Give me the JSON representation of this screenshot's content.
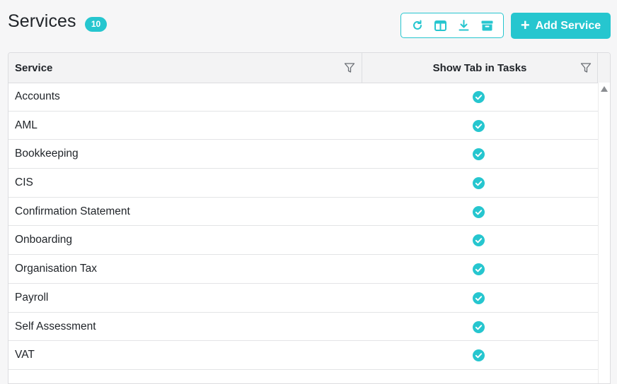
{
  "header": {
    "title": "Services",
    "count": "10",
    "add_button_label": "Add Service",
    "toolbar_icons": [
      "refresh-icon",
      "columns-icon",
      "download-icon",
      "archive-icon"
    ]
  },
  "grid": {
    "columns": [
      "Service",
      "Show Tab in Tasks"
    ],
    "rows": [
      {
        "service": "Accounts",
        "show_tab": true
      },
      {
        "service": "AML",
        "show_tab": true
      },
      {
        "service": "Bookkeeping",
        "show_tab": true
      },
      {
        "service": "CIS",
        "show_tab": true
      },
      {
        "service": "Confirmation Statement",
        "show_tab": true
      },
      {
        "service": "Onboarding",
        "show_tab": true
      },
      {
        "service": "Organisation Tax",
        "show_tab": true
      },
      {
        "service": "Payroll",
        "show_tab": true
      },
      {
        "service": "Self Assessment",
        "show_tab": true
      },
      {
        "service": "VAT",
        "show_tab": true
      }
    ]
  },
  "colors": {
    "accent": "#26c6cf",
    "text": "#1f2328",
    "header_bg": "#f3f3f4",
    "border": "#dcdde0",
    "page_bg": "#f6f6f7"
  }
}
